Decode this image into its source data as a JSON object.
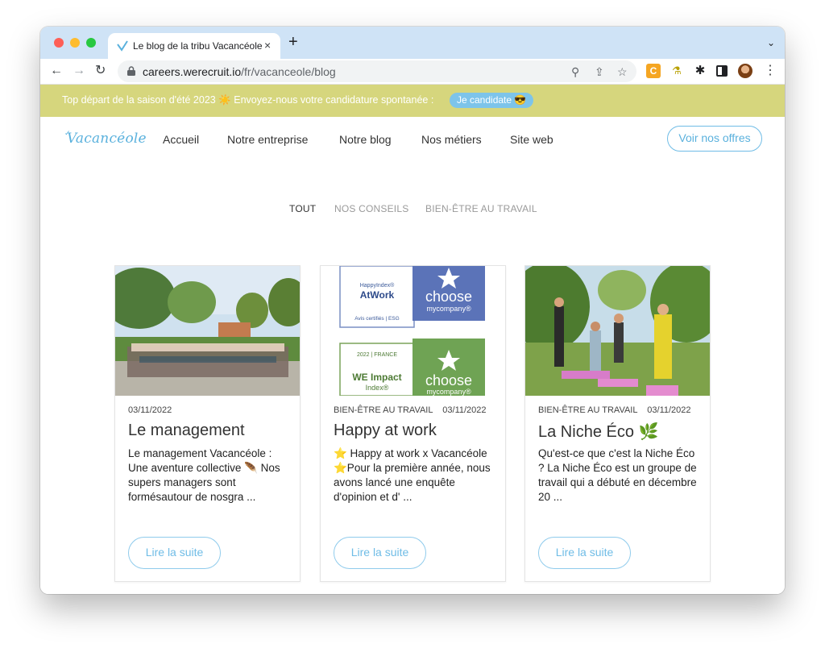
{
  "browser": {
    "tab_title": "Le blog de la tribu Vacancéole",
    "tab_close": "×",
    "new_tab": "+",
    "tabs_menu": "⌄",
    "back": "←",
    "forward": "→",
    "reload": "↻",
    "url_host": "careers.werecruit.io",
    "url_path": "/fr/vacanceole/blog",
    "zoom_icon": "⚲",
    "share_icon": "⇪",
    "bookmark_icon": "☆",
    "ext_c_label": "C",
    "menu": "⋮"
  },
  "banner": {
    "text": "Top départ de la saison d'été 2023 ☀️ Envoyez-nous votre candidature spontanée :",
    "button": "Je candidate 😎",
    "color": "#d6d67d"
  },
  "site": {
    "logo": "Vacancéole",
    "nav": [
      "Accueil",
      "Notre entreprise",
      "Notre blog",
      "Nos métiers",
      "Site web"
    ],
    "cta": "Voir nos offres",
    "accent": "#5ab1dd"
  },
  "filters": {
    "all": "TOUT",
    "advice": "NOS CONSEILS",
    "wellbeing": "BIEN-ÊTRE AU TRAVAIL"
  },
  "cards": [
    {
      "meta": "03/11/2022",
      "title": "Le management",
      "body": "Le management Vacancéole : Une aventure collective 🪶 Nos supers managers sont formésautour de nosgra ...",
      "read_more": "Lire la suite"
    },
    {
      "meta": "BIEN-ÊTRE AU TRAVAIL    03/11/2022",
      "title": "Happy at work",
      "body": "⭐ Happy at work x Vacancéole ⭐Pour la première année, nous avons lancé une enquête d'opinion et d' ...",
      "read_more": "Lire la suite",
      "badge_top": {
        "line1": "HappyIndex®",
        "line2": "AtWork",
        "footer": "Avis certifiés | ESG",
        "brand": "choose",
        "brand2": "mycompany®"
      },
      "badge_bottom": {
        "line0": "2022 | FRANCE",
        "line1": "WE Impact",
        "line2": "Index®",
        "brand": "choose",
        "brand2": "mycompany®"
      }
    },
    {
      "meta": "BIEN-ÊTRE AU TRAVAIL    03/11/2022",
      "title": "La Niche Éco 🌿",
      "body": "Qu'est-ce que c'est la Niche Éco ? La Niche Éco est un groupe de travail qui a débuté en décembre 20 ...",
      "read_more": "Lire la suite"
    }
  ]
}
